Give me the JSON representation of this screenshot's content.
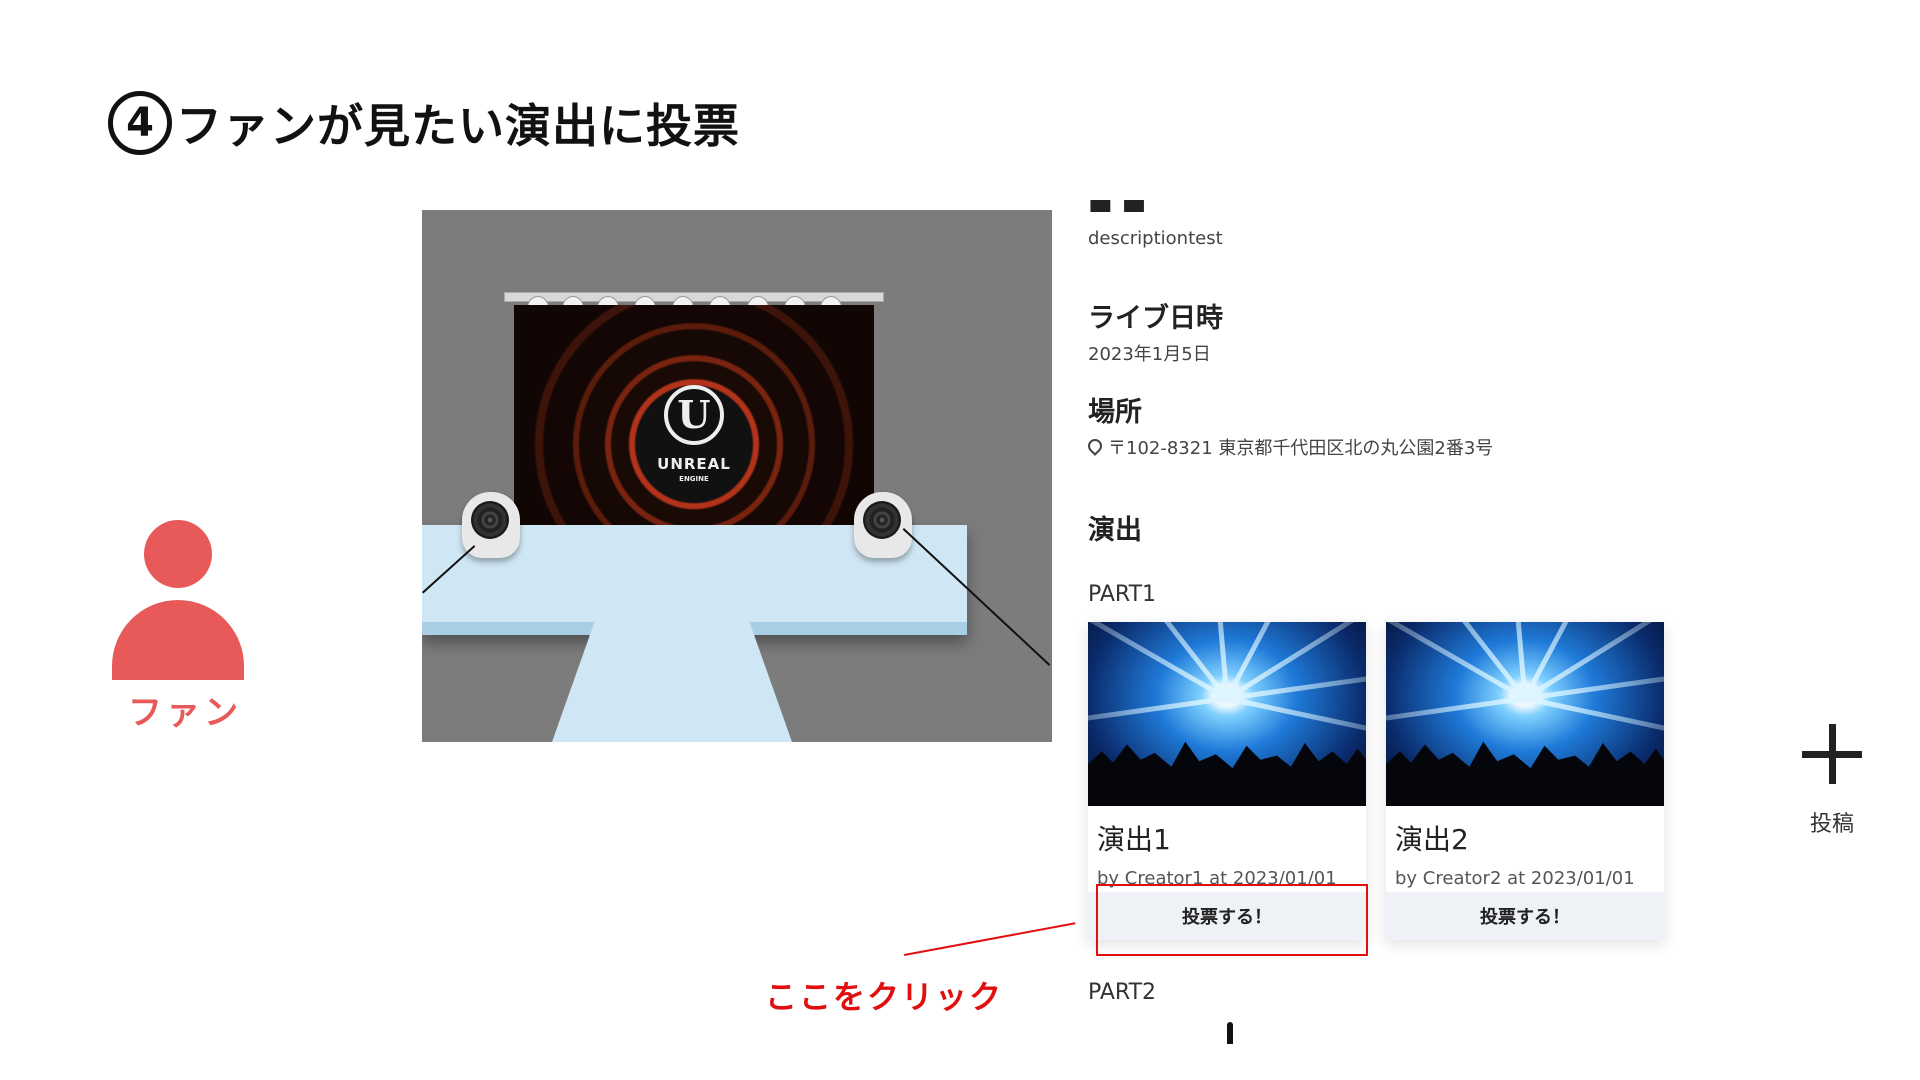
{
  "slide": {
    "step_number": "4",
    "title": "ファンが見たい演出に投票"
  },
  "actor": {
    "icon": "person-icon",
    "label": "ファン",
    "color": "#e85a5a"
  },
  "stage_image": {
    "logo_text": "UNREAL",
    "logo_subtext": "ENGINE"
  },
  "details": {
    "description_value": "descriptiontest",
    "live_date_heading": "ライブ日時",
    "live_date_value": "2023年1月5日",
    "venue_heading": "場所",
    "venue_value": "〒102-8321 東京都千代田区北の丸公園2番3号",
    "performance_heading": "演出"
  },
  "parts": [
    {
      "label": "PART1",
      "cards": [
        {
          "title": "演出1",
          "meta": "by Creator1 at 2023/01/01",
          "vote_label": "投票する！"
        },
        {
          "title": "演出2",
          "meta": "by Creator2 at 2023/01/01",
          "vote_label": "投票する！"
        }
      ]
    },
    {
      "label": "PART2",
      "cards": []
    }
  ],
  "post_button": {
    "icon": "plus-icon",
    "label": "投稿"
  },
  "annotation": {
    "text": "ここをクリック",
    "color": "#e01010"
  }
}
